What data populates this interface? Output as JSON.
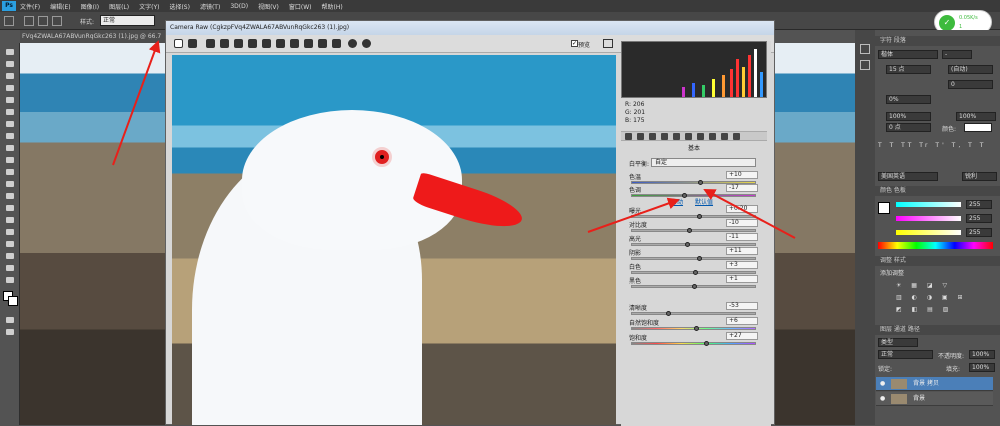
{
  "menubar": {
    "logo": "Ps",
    "items": [
      "文件(F)",
      "编辑(E)",
      "图像(I)",
      "图层(L)",
      "文字(Y)",
      "选择(S)",
      "滤镜(T)",
      "3D(D)",
      "视图(V)",
      "窗口(W)",
      "帮助(H)"
    ]
  },
  "options": {
    "style_label": "样式:",
    "style_value": "正常"
  },
  "doc_tab": "FVq4ZWALA67ABVunRqGkc263 (1).jpg @ 66.7",
  "camera_raw": {
    "title": "Camera Raw (CgkzpFVq4ZWALA67ABVunRqGkc263 (1).jpg)",
    "preview_label": "预览",
    "preview_check": "✓",
    "rgb": {
      "r_label": "R:",
      "r": "206",
      "g_label": "G:",
      "g": "201",
      "b_label": "B:",
      "b": "175"
    },
    "panel_title": "基本",
    "wb_label": "白平衡:",
    "wb_value": "自定",
    "auto_link": "自动",
    "default_link": "默认值",
    "sliders": [
      {
        "label": "色温",
        "value": "+10"
      },
      {
        "label": "色调",
        "value": "-17"
      },
      {
        "label": "曝光",
        "value": "+0.20"
      },
      {
        "label": "对比度",
        "value": "-10"
      },
      {
        "label": "高光",
        "value": "-11"
      },
      {
        "label": "阴影",
        "value": "+11"
      },
      {
        "label": "白色",
        "value": "+3"
      },
      {
        "label": "黑色",
        "value": "+1"
      },
      {
        "label": "清晰度",
        "value": "-53"
      },
      {
        "label": "自然饱和度",
        "value": "+6"
      },
      {
        "label": "饱和度",
        "value": "+27"
      }
    ]
  },
  "network": {
    "up": "0.05K/s",
    "down": "1"
  },
  "ps_panels": {
    "character_tabs": "字符  段落",
    "font_family": "楷体",
    "font_size": "15 点",
    "leading": "(自动)",
    "tracking": "0",
    "kerning": "0%",
    "scale_v": "100%",
    "scale_h": "100%",
    "baseline": "0 点",
    "color_label": "颜色:",
    "aa_value": "锐利",
    "lang_value": "美国英语",
    "color_tabs": "颜色  色板",
    "r_value": "255",
    "g_value": "255",
    "b_value": "255",
    "adjust_tabs": "调整  样式",
    "adjust_title": "添加调整",
    "layers_tabs": "图层  通道  路径",
    "kind_label": "类型",
    "blend_mode": "正常",
    "opacity_label": "不透明度:",
    "opacity": "100%",
    "lock_label": "锁定:",
    "fill_label": "填充:",
    "fill": "100%",
    "layers": [
      {
        "name": "背景 拷贝",
        "selected": true
      },
      {
        "name": "背景",
        "selected": false
      }
    ]
  }
}
